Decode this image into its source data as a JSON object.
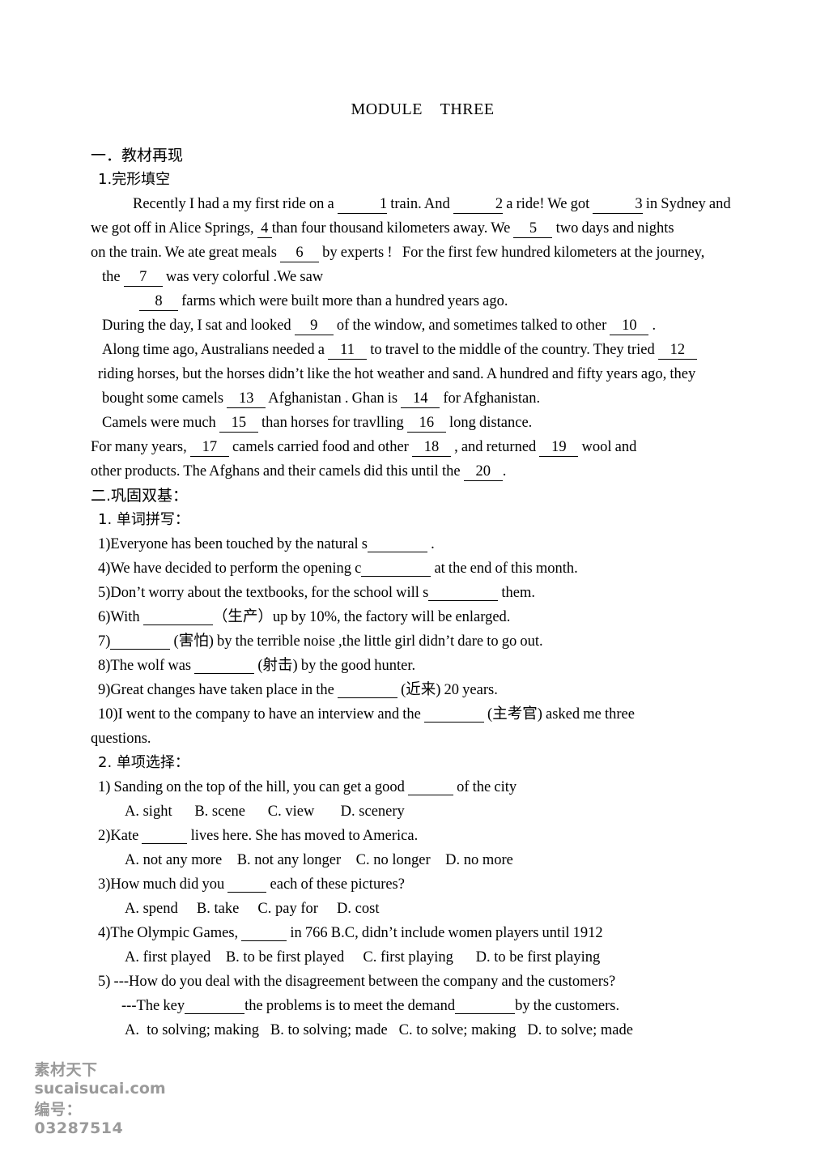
{
  "document": {
    "title": "MODULE    THREE"
  },
  "section_one": {
    "heading": "一．教材再现",
    "subheading": "1.完形填空",
    "cloze": {
      "lines": [
        {
          "id": "cloze-line-1",
          "parts": [
            {
              "t": "text",
              "v": "Recently I had a my first ride on a "
            },
            {
              "t": "blank",
              "v": "1"
            },
            {
              "t": "text",
              "v": " train. And "
            },
            {
              "t": "blank",
              "v": "2"
            },
            {
              "t": "text",
              "v": " a ride! We got "
            },
            {
              "t": "blank",
              "v": "3"
            },
            {
              "t": "text",
              "v": " in Sydney and"
            }
          ]
        },
        {
          "id": "cloze-line-2",
          "parts": [
            {
              "t": "text",
              "v": "we got off in Alice Springs, "
            },
            {
              "t": "blank",
              "v": "4"
            },
            {
              "t": "text",
              "v": "than four thousand kilometers away. We "
            },
            {
              "t": "blank",
              "v": "5"
            },
            {
              "t": "text",
              "v": " two days and nights"
            }
          ]
        },
        {
          "id": "cloze-line-3",
          "parts": [
            {
              "t": "text",
              "v": "on the train. We ate great meals "
            },
            {
              "t": "blank",
              "v": "6"
            },
            {
              "t": "text",
              "v": " by experts !   For the first few hundred kilometers at the journey,"
            }
          ]
        },
        {
          "id": "cloze-line-4",
          "parts": [
            {
              "t": "text",
              "v": "the "
            },
            {
              "t": "blank",
              "v": "7"
            },
            {
              "t": "text",
              "v": " was very colorful .We saw"
            }
          ]
        },
        {
          "id": "cloze-line-5",
          "parts": [
            {
              "t": "blank",
              "v": "8"
            },
            {
              "t": "text",
              "v": " farms which were built more than a hundred years ago."
            }
          ]
        },
        {
          "id": "cloze-line-6",
          "parts": [
            {
              "t": "text",
              "v": "During the day, I sat and looked "
            },
            {
              "t": "blank",
              "v": "9"
            },
            {
              "t": "text",
              "v": " of the window, and sometimes talked to other "
            },
            {
              "t": "blank",
              "v": "10"
            },
            {
              "t": "text",
              "v": " ."
            }
          ]
        },
        {
          "id": "cloze-line-7",
          "parts": [
            {
              "t": "text",
              "v": "Along time ago, Australians needed a "
            },
            {
              "t": "blank",
              "v": "11"
            },
            {
              "t": "text",
              "v": " to travel to the middle of the country. They tried "
            },
            {
              "t": "blank",
              "v": "12"
            }
          ]
        },
        {
          "id": "cloze-line-8",
          "parts": [
            {
              "t": "text",
              "v": "riding horses, but the horses didn’t like the hot weather and sand. A hundred and fifty years ago, they"
            }
          ]
        },
        {
          "id": "cloze-line-9",
          "parts": [
            {
              "t": "text",
              "v": "bought some camels "
            },
            {
              "t": "blank",
              "v": "13"
            },
            {
              "t": "text",
              "v": " Afghanistan . Ghan is "
            },
            {
              "t": "blank",
              "v": "14"
            },
            {
              "t": "text",
              "v": " for Afghanistan."
            }
          ]
        },
        {
          "id": "cloze-line-10",
          "parts": [
            {
              "t": "text",
              "v": "Camels were much "
            },
            {
              "t": "blank",
              "v": "15"
            },
            {
              "t": "text",
              "v": " than horses for travlling "
            },
            {
              "t": "blank",
              "v": "16"
            },
            {
              "t": "text",
              "v": " long distance."
            }
          ]
        },
        {
          "id": "cloze-line-11",
          "parts": [
            {
              "t": "text",
              "v": "For many years, "
            },
            {
              "t": "blank",
              "v": "17"
            },
            {
              "t": "text",
              "v": " camels carried food and other "
            },
            {
              "t": "blank",
              "v": "18"
            },
            {
              "t": "text",
              "v": " , and returned "
            },
            {
              "t": "blank",
              "v": "19"
            },
            {
              "t": "text",
              "v": " wool and"
            }
          ]
        },
        {
          "id": "cloze-line-12",
          "parts": [
            {
              "t": "text",
              "v": "other products. The Afghans and their camels did this until the "
            },
            {
              "t": "blank",
              "v": "20"
            },
            {
              "t": "text",
              "v": "."
            }
          ]
        }
      ]
    }
  },
  "section_two": {
    "heading": "二.巩固双基：",
    "part1": {
      "heading": "1.  单词拼写：",
      "items": [
        {
          "num": "1)",
          "pre": "Everyone has been touched by the natural s",
          "post": " ."
        },
        {
          "num": "4)",
          "pre": "We have decided to perform the opening c",
          "post": " at the end of this month."
        },
        {
          "num": "5)",
          "pre": "Don’t worry about the textbooks, for the school will s",
          "post": " them."
        },
        {
          "num": "6)",
          "pre": "With ",
          "post": "（生产）up by 10%, the factory will be enlarged."
        },
        {
          "num": "7)",
          "pre": "",
          "post": " (害怕) by the terrible noise ,the little girl didn’t dare to go out."
        },
        {
          "num": "8)",
          "pre": "The wolf was ",
          "post": " (射击) by the good hunter."
        },
        {
          "num": "9)",
          "pre": "Great changes have taken place in the ",
          "post": " (近来) 20 years."
        },
        {
          "num": "10)",
          "pre": "I went to the company to have an interview and the ",
          "post": " (主考官) asked me three"
        },
        {
          "num": "",
          "pre": "questions.",
          "post": ""
        }
      ]
    },
    "part2": {
      "heading": "2.  单项选择：",
      "questions": [
        {
          "num": "1)",
          "stem_pre": " Sanding on the top of the hill, you can get a good ",
          "stem_post": " of the city",
          "options": "A. sight      B. scene      C. view       D. scenery"
        },
        {
          "num": "2)",
          "stem_pre": "Kate ",
          "stem_post": " lives here. She has moved to America.",
          "options": "A. not any more    B. not any longer    C. no longer    D. no more"
        },
        {
          "num": "3)",
          "stem_pre": "How much did you ",
          "stem_post": " each of these pictures?",
          "options": "A. spend     B. take     C. pay for     D. cost"
        },
        {
          "num": "4)",
          "stem_pre": "The Olympic Games, ",
          "stem_post": " in 766 B.C, didn’t include women players until 1912",
          "options": "A. first played    B. to be first played     C. first playing      D. to be first playing"
        }
      ],
      "question5": {
        "num": "5)",
        "line1": " ---How do you deal with the disagreement between the company and the customers?",
        "line2_a": "---The key",
        "line2_b": "the problems is to meet the demand",
        "line2_c": "by the customers.",
        "options": "A.  to solving; making   B. to solving; made   C. to solve; making   D. to solve; made"
      }
    }
  },
  "footer": {
    "brand": "素材天下",
    "site": "sucaisucai.com",
    "code_label": "编号：",
    "code_value": "03287514"
  }
}
